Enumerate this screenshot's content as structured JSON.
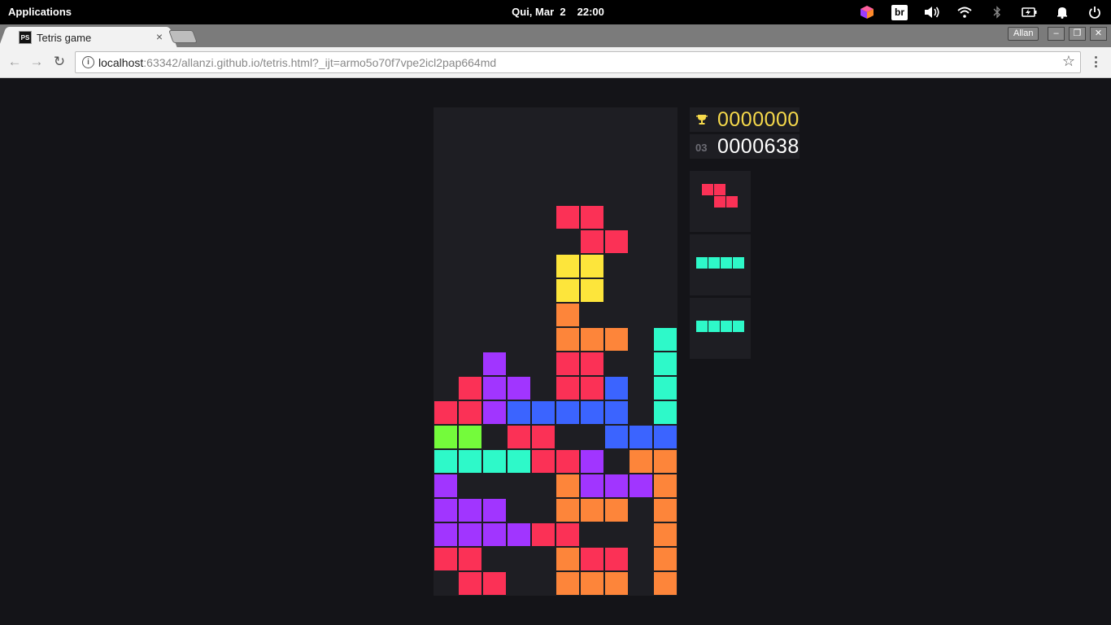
{
  "system_bar": {
    "apps_label": "Applications",
    "date": "Qui, Mar  2",
    "time": "22:00",
    "tray_icons": [
      "app-cube-icon",
      "br-badge",
      "volume-icon",
      "wifi-icon",
      "bluetooth-icon",
      "battery-icon",
      "notification-bell-icon",
      "power-icon"
    ],
    "br_label": "br"
  },
  "browser": {
    "tab_title": "Tetris game",
    "tab_favicon": "PS",
    "tab_close": "×",
    "profile_name": "Allan",
    "url_host": "localhost",
    "url_rest": ":63342/allanzi.github.io/tetris.html?_ijt=armo5o70f7vpe2icl2pap664md",
    "star": "☆"
  },
  "game": {
    "high_score": "0000000",
    "level": "03",
    "score": "0000638",
    "colors": {
      "R": "#fb3156",
      "Y": "#fde53b",
      "O": "#fd853a",
      "C": "#2ef9c9",
      "P": "#a135ff",
      "B": "#3b64ff",
      "G": "#74fb3b"
    },
    "board": [
      "..........",
      "..........",
      "..........",
      "..........",
      ".....RR...",
      "......RR..",
      ".....YY...",
      ".....YY...",
      ".....O....",
      ".....OOO.C",
      "..P..RR..C",
      ".RPP.RRB.C",
      "RRPBBBBB.C",
      "GG.RR..BBB",
      "CCCCRRP.OO",
      "P....OPPPO.",
      "PPP..OOO.O",
      "PPPPRR...OO",
      "RR...ORR.O",
      ".RR..OOO.O"
    ],
    "next_pieces": [
      {
        "color": "R",
        "shape": [
          "RR.",
          ".RR"
        ]
      },
      {
        "color": "C",
        "shape": [
          "CCCC"
        ]
      },
      {
        "color": "C",
        "shape": [
          "CCCC"
        ]
      }
    ]
  }
}
